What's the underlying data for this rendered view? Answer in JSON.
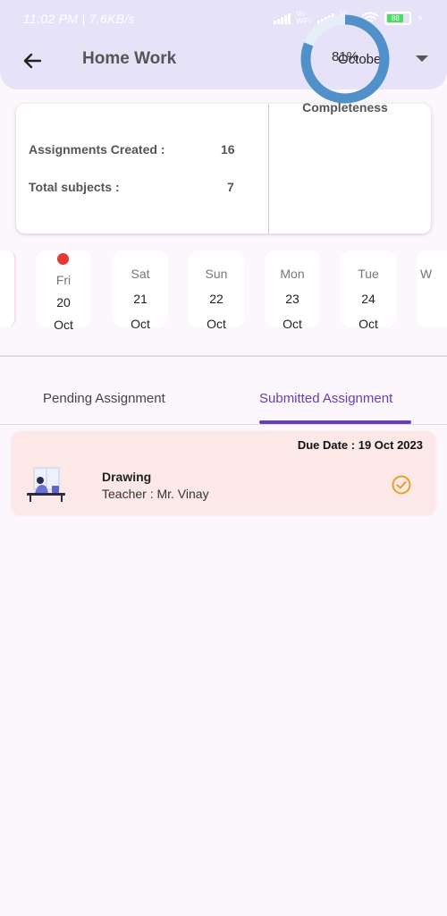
{
  "status_bar": {
    "time": "11:02 PM | 7.6KB/s",
    "volte_1": "Vo WiFi",
    "volte_2": "Vo WiFi",
    "battery": "88"
  },
  "header": {
    "title": "Home Work",
    "month": "October",
    "back_icon": "arrow-left-icon",
    "dropdown_icon": "caret-down-icon"
  },
  "stats": {
    "assignments_label": "Assignments Created :",
    "assignments_value": "16",
    "subjects_label": "Total subjects :",
    "subjects_value": "7",
    "completeness_percent": 81,
    "completeness_text": "81%",
    "completeness_label": "Completeness",
    "ring_color": "#4f91c8",
    "ring_track_color": "#e6eef7"
  },
  "dates": [
    {
      "day": "Fri",
      "num": "20",
      "month": "Oct",
      "has_dot": true
    },
    {
      "day": "Sat",
      "num": "21",
      "month": "Oct",
      "has_dot": false
    },
    {
      "day": "Sun",
      "num": "22",
      "month": "Oct",
      "has_dot": false
    },
    {
      "day": "Mon",
      "num": "23",
      "month": "Oct",
      "has_dot": false
    },
    {
      "day": "Tue",
      "num": "24",
      "month": "Oct",
      "has_dot": false
    },
    {
      "day": "W",
      "num": "",
      "month": "",
      "has_dot": false
    }
  ],
  "tabs": {
    "pending": "Pending Assignment",
    "submitted": "Submitted Assignment",
    "active": "submitted",
    "active_color": "#6a3db1"
  },
  "assignments": [
    {
      "due_date": "Due Date : 19 Oct 2023",
      "subject": "Drawing",
      "teacher": "Teacher : Mr. Vinay",
      "icon": "check-circle-icon",
      "icon_color": "#e8a020"
    }
  ]
}
